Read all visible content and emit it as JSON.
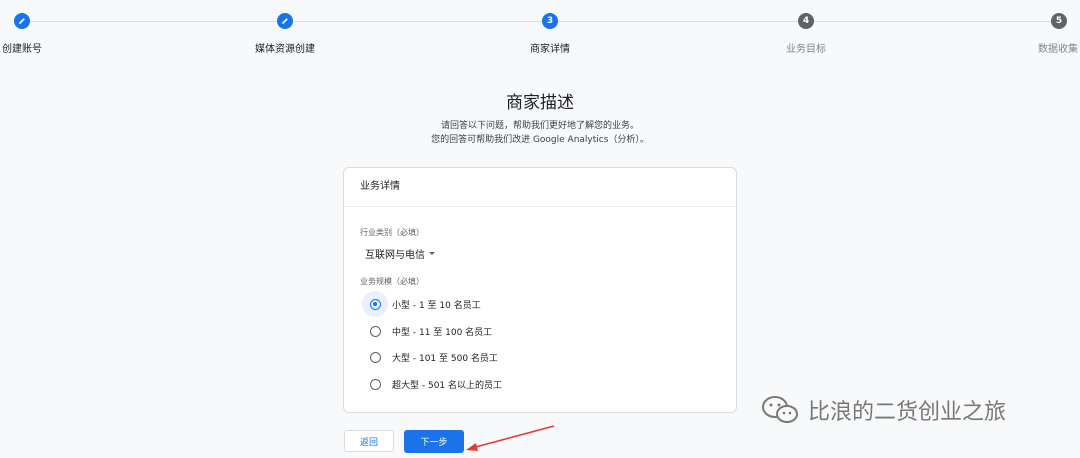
{
  "stepper": {
    "steps": [
      {
        "label": "创建账号",
        "state": "done",
        "icon": "pencil-icon"
      },
      {
        "label": "媒体资源创建",
        "state": "done",
        "icon": "pencil-icon"
      },
      {
        "label": "商家详情",
        "state": "active",
        "number": "3"
      },
      {
        "label": "业务目标",
        "state": "pending",
        "number": "4"
      },
      {
        "label": "数据收集",
        "state": "pending",
        "number": "5"
      }
    ]
  },
  "page": {
    "title": "商家描述",
    "subtitle_line1": "请回答以下问题，帮助我们更好地了解您的业务。",
    "subtitle_line2": "您的回答可帮助我们改进 Google Analytics（分析）。"
  },
  "card": {
    "header": "业务详情",
    "industry": {
      "label": "行业类别（必填）",
      "selected": "互联网与电信"
    },
    "size": {
      "label": "业务规模（必填）",
      "options": [
        {
          "label": "小型 - 1 至 10 名员工",
          "checked": true
        },
        {
          "label": "中型 - 11 至 100 名员工",
          "checked": false
        },
        {
          "label": "大型 - 101 至 500 名员工",
          "checked": false
        },
        {
          "label": "超大型 - 501 名以上的员工",
          "checked": false
        }
      ]
    }
  },
  "buttons": {
    "back": "返回",
    "next": "下一步"
  },
  "watermark": {
    "text": "比浪的二货创业之旅"
  },
  "colors": {
    "accent": "#1a73e8",
    "pending": "#5f6368",
    "annotation_arrow": "#e53935"
  }
}
